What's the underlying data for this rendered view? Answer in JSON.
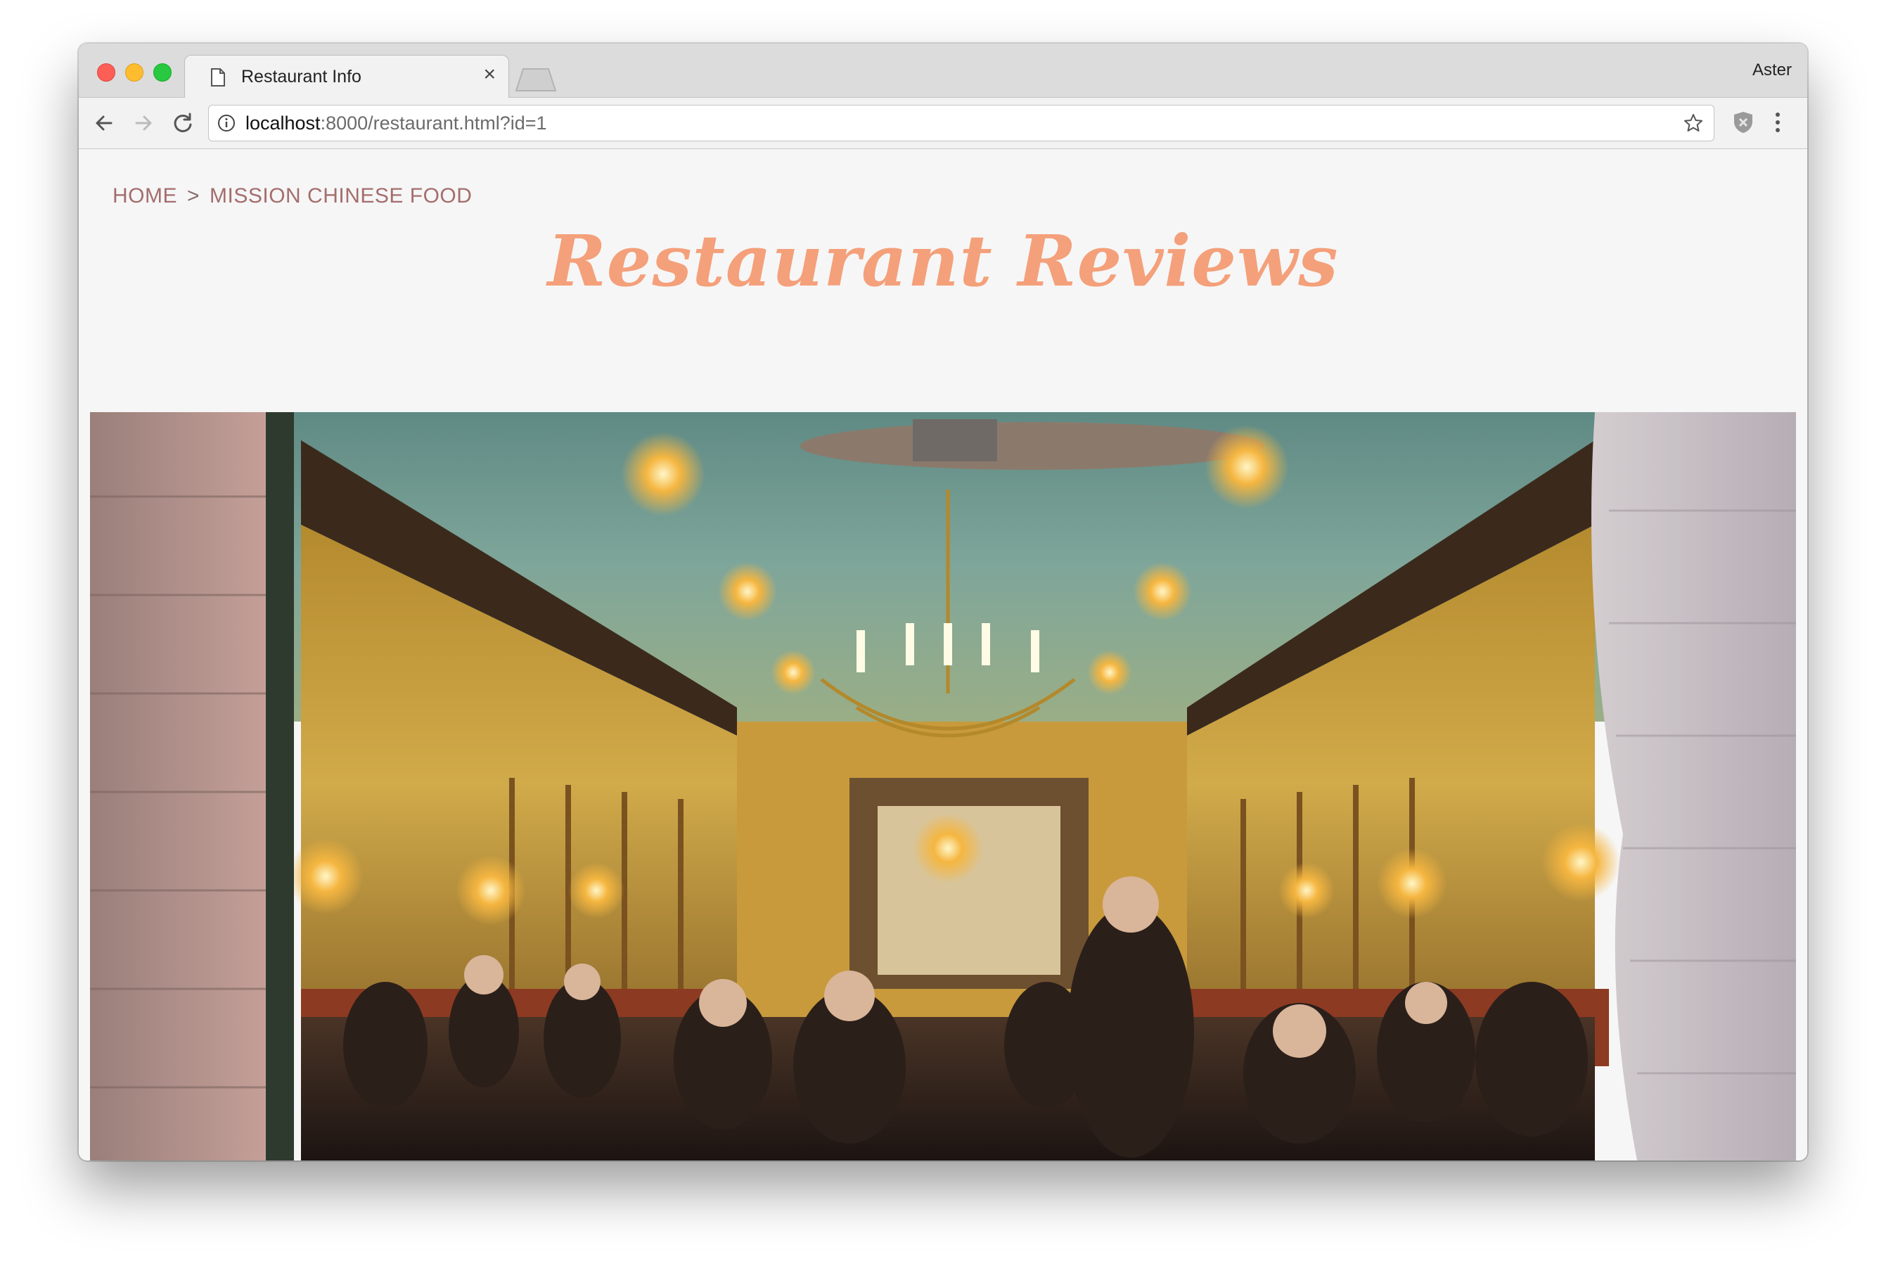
{
  "browser": {
    "tab_title": "Restaurant Info",
    "tab_close": "×",
    "profile_name": "Aster",
    "url_host": "localhost",
    "url_rest": ":8000/restaurant.html?id=1"
  },
  "page": {
    "breadcrumb": {
      "home": "HOME",
      "separator": ">",
      "current": "MISSION CHINESE FOOD"
    },
    "site_title": "Restaurant Reviews"
  },
  "icons": {
    "back": "back-arrow-icon",
    "forward": "forward-arrow-icon",
    "reload": "reload-icon",
    "info": "info-icon",
    "bookmark": "star-icon",
    "extension": "shield-icon",
    "menu": "kebab-menu-icon",
    "tab_page": "page-icon"
  },
  "colors": {
    "title_accent": "#f4a07a",
    "breadcrumb": "#a56d6d",
    "page_bg": "#f6f6f6"
  }
}
